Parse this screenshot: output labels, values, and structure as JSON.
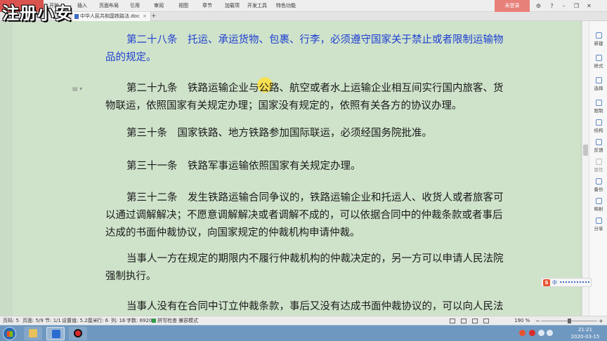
{
  "watermark": "注册小安",
  "menubar": {
    "items": [
      "开始",
      "插入",
      "页面布局",
      "引用",
      "审阅",
      "视图",
      "章节",
      "加载项",
      "开发工具",
      "特色功能"
    ],
    "login_label": "未登录",
    "window_controls": [
      "minimize-icon",
      "restore-icon",
      "close-icon"
    ]
  },
  "tabbar": {
    "doc_tab_label": "中华人民共和国铁路法.doc",
    "close_glyph": "×",
    "new_tab_glyph": "+"
  },
  "document": {
    "paragraphs": [
      {
        "line1": "第二十八条　托运、承运货物、包裹、行李，必须遵守国家关于禁止或者限制运输物",
        "line2": "品的规定。",
        "color": "#1f3fd1"
      },
      {
        "line1": "第二十九条　铁路运输企业与公路、航空或者水上运输企业相互间实行国内旅客、货",
        "line2": "物联运，依照国家有关规定办理；国家没有规定的，依照有关各方的协议办理。",
        "color": "#1a1a1a"
      },
      {
        "line1": "第三十条　国家铁路、地方铁路参加国际联运，必须经国务院批准。",
        "color": "#1a1a1a"
      },
      {
        "line1": "第三十一条　铁路军事运输依照国家有关规定办理。",
        "color": "#1a1a1a"
      },
      {
        "line1": "第三十二条　发生铁路运输合同争议的，铁路运输企业和托运人、收货人或者旅客可",
        "line2": "以通过调解解决；不愿意调解解决或者调解不成的，可以依据合同中的仲裁条款或者事后",
        "line3": "达成的书面仲裁协议，向国家规定的仲裁机构申请仲裁。",
        "color": "#1a1a1a"
      },
      {
        "line1": "当事人一方在规定的期限内不履行仲裁机构的仲裁决定的，另一方可以申请人民法院",
        "line2": "强制执行。",
        "color": "#1a1a1a"
      },
      {
        "line1": "当事人没有在合同中订立仲裁条款，事后又没有达成书面仲裁协议的，可以向人民法",
        "color": "#1a1a1a"
      }
    ]
  },
  "rightpanel": {
    "items": [
      "新建",
      "样式",
      "选择",
      "限制",
      "结构",
      "反馈",
      "属性",
      "备份",
      "映射",
      "分享"
    ]
  },
  "ime": {
    "logo": "S",
    "lang": "中"
  },
  "statusbar": {
    "page_num": "页码: 5",
    "pages": "页面: 5/9",
    "section": "节: 1/1",
    "setting": "设置值: 5.2厘米",
    "row": "行: 6",
    "col": "列: 16",
    "word_count": "字数: 6920",
    "spell_check": "拼写检查",
    "compat_mode": "兼容模式",
    "zoom": "190 %"
  },
  "taskbar": {
    "time": "21:21",
    "date": "2020-03-15"
  }
}
